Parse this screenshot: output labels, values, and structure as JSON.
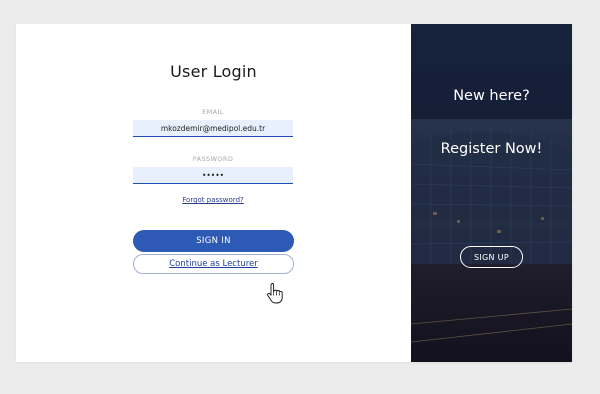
{
  "login": {
    "title": "User Login",
    "email_label": "EMAIL",
    "email_value": "mkozdemir@medipol.edu.tr",
    "password_label": "PASSWORD",
    "password_value": "•••••",
    "forgot_label": "Forgot password?",
    "signin_label": "SIGN IN",
    "lecturer_label": "Continue as Lecturer"
  },
  "signup": {
    "heading": "New here?",
    "subheading": "Register Now!",
    "button_label": "SIGN UP"
  },
  "icons": {
    "cursor": "hand-pointer-icon"
  },
  "colors": {
    "primary": "#2d5ab4",
    "field_bg": "#e9f0fd",
    "panel_dark": "#1a2540",
    "page_bg": "#ececec"
  }
}
